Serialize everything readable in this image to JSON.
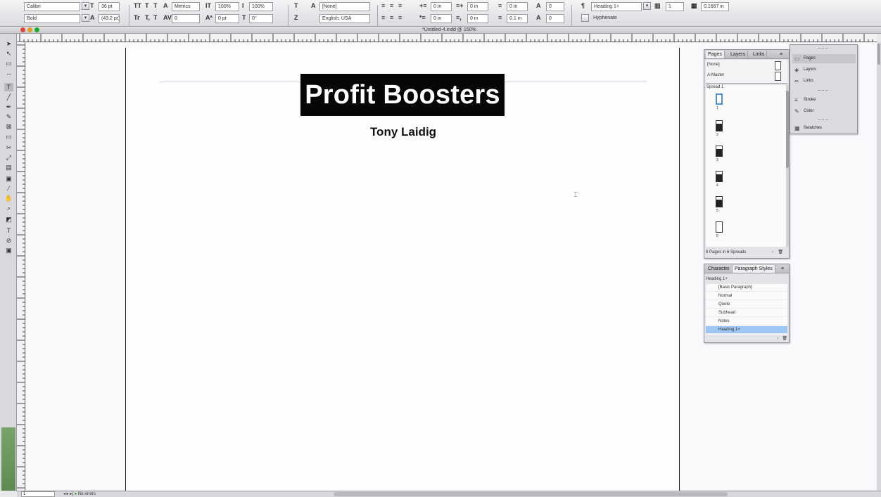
{
  "control_panel": {
    "font_family": "Calibri",
    "font_style": "Bold",
    "font_size": "36 pt",
    "leading": "(43.2 pt)",
    "kerning": "Metrics",
    "tracking": "0",
    "vertical_scale": "100%",
    "horizontal_scale": "100%",
    "baseline_shift": "0 pt",
    "skew": "0°",
    "character_style": "[None]",
    "language": "English: USA",
    "left_indent": "0 in",
    "right_indent": "0 in",
    "first_line_indent": "0 in",
    "last_line_indent": "0 in",
    "space_before": "0 in",
    "space_after": "0.1 in",
    "drop_cap_lines": "0",
    "drop_cap_chars": "0",
    "paragraph_style": "Heading 1+",
    "hyphenate_label": "Hyphenate",
    "columns": "1",
    "gutter": "0.1667 in"
  },
  "title_bar": {
    "title": "*Untitled-4.indd @ 150%"
  },
  "document": {
    "title": "Profit Boosters",
    "author": "Tony Laidig"
  },
  "pages_panel": {
    "tabs": [
      "Pages",
      "Layers",
      "Links"
    ],
    "masters": [
      "[None]",
      "A-Master"
    ],
    "spread_label": "Spread 1",
    "page_numbers": [
      "1",
      "2",
      "3",
      "4",
      "5",
      "6"
    ],
    "footer": "6 Pages in 6 Spreads"
  },
  "paragraph_panel": {
    "tabs": [
      "Character",
      "Paragraph Styles"
    ],
    "current_style": "Heading 1+",
    "styles": [
      "[Basic Paragraph]",
      "Normal",
      "Quote",
      "Subhead",
      "Notes",
      "Heading 1+"
    ],
    "selected_index": 5
  },
  "dock": {
    "items": [
      "Pages",
      "Layers",
      "Links",
      "Stroke",
      "Color",
      "Swatches"
    ]
  },
  "status_bar": {
    "page_number": "1",
    "preflight": "No errors"
  }
}
